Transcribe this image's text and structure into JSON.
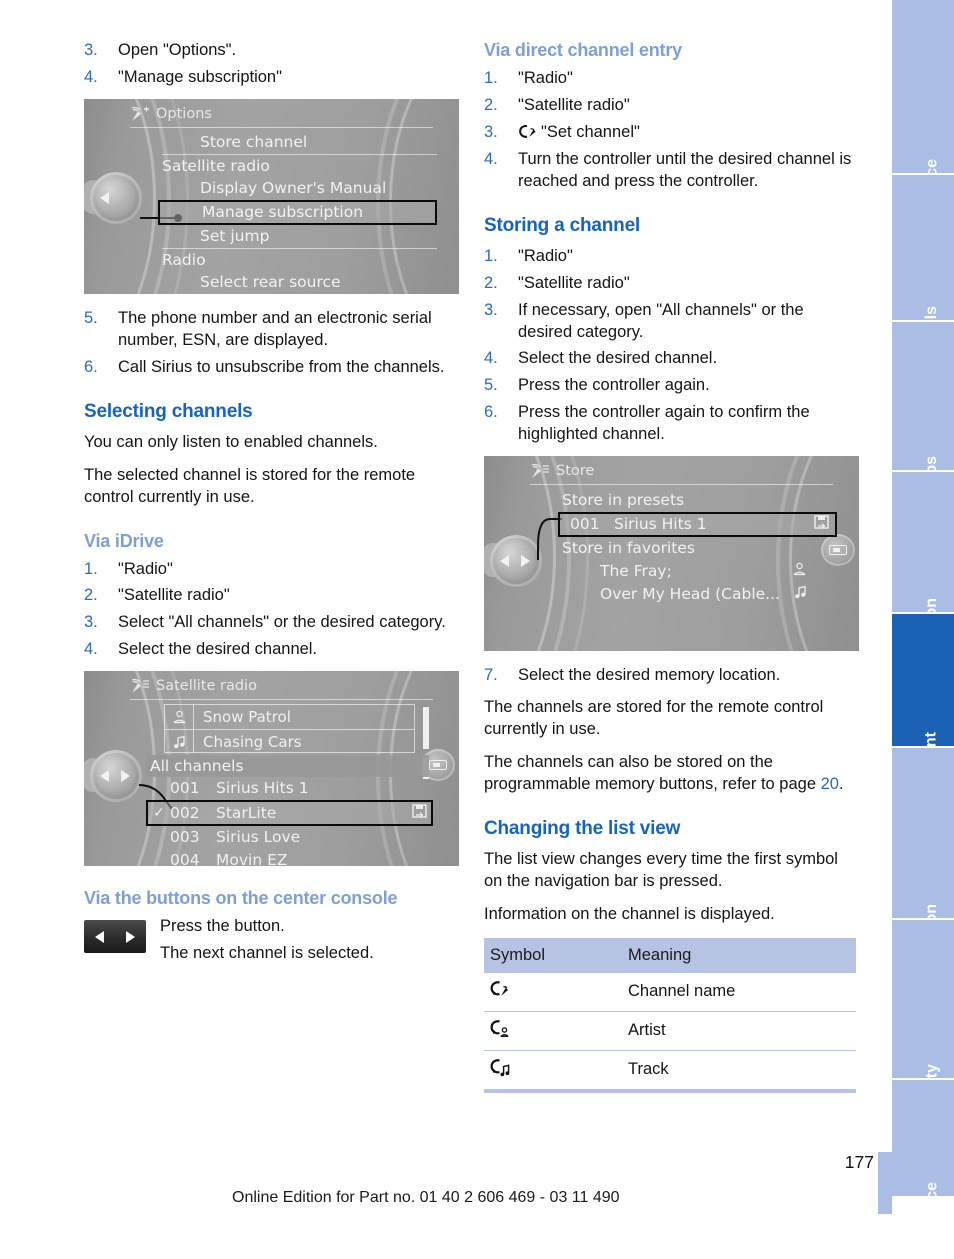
{
  "page": {
    "number": "177",
    "footer": "Online Edition for Part no. 01 40 2 606 469 - 03 11 490"
  },
  "sidebar": {
    "tabs": [
      {
        "label": "At a glance",
        "active": false
      },
      {
        "label": "Controls",
        "active": false
      },
      {
        "label": "Driving tips",
        "active": false
      },
      {
        "label": "Navigation",
        "active": false
      },
      {
        "label": "Entertainment",
        "active": true
      },
      {
        "label": "Communication",
        "active": false
      },
      {
        "label": "Mobility",
        "active": false
      },
      {
        "label": "Reference",
        "active": false
      }
    ],
    "active_color": "#1b62b5",
    "inactive_color": "#aabde4"
  },
  "left_column": {
    "steps_top": [
      {
        "num": "3.",
        "text": "Open \"Options\"."
      },
      {
        "num": "4.",
        "text": "\"Manage subscription\""
      }
    ],
    "options_screen": {
      "title": "Options",
      "icon": "satellite-plus-icon",
      "rows": [
        {
          "label": "Store channel",
          "indent": 2,
          "selected": false,
          "separator_above": false
        },
        {
          "label": "Satellite radio",
          "indent": 1,
          "selected": false,
          "separator_above": true
        },
        {
          "label": "Display Owner's Manual",
          "indent": 2,
          "selected": false,
          "separator_above": false
        },
        {
          "label": "Manage subscription",
          "indent": 2,
          "selected": true,
          "separator_above": false
        },
        {
          "label": "Set jump",
          "indent": 2,
          "selected": false,
          "separator_above": false
        },
        {
          "label": "Radio",
          "indent": 1,
          "selected": false,
          "separator_above": true
        },
        {
          "label": "Select rear source",
          "indent": 2,
          "selected": false,
          "separator_above": false
        }
      ]
    },
    "steps_bottom": [
      {
        "num": "5.",
        "text": "The phone number and an electronic serial number, ESN, are displayed."
      },
      {
        "num": "6.",
        "text": "Call Sirius to unsubscribe from the channels."
      }
    ],
    "selecting_channels": {
      "heading": "Selecting channels",
      "paragraphs": [
        "You can only listen to enabled channels.",
        "The selected channel is stored for the remote control currently in use."
      ]
    },
    "via_idrive": {
      "heading": "Via iDrive",
      "steps": [
        {
          "num": "1.",
          "text": "\"Radio\""
        },
        {
          "num": "2.",
          "text": "\"Satellite radio\""
        },
        {
          "num": "3.",
          "text": "Select \"All channels\" or the desired category."
        },
        {
          "num": "4.",
          "text": "Select the desired channel."
        }
      ]
    },
    "satellite_screen": {
      "title": "Satellite radio",
      "icon": "satellite-list-icon",
      "now_playing": [
        {
          "icon": "artist-icon",
          "text": "Snow Patrol"
        },
        {
          "icon": "track-icon",
          "text": "Chasing Cars"
        }
      ],
      "list_header": "All channels",
      "channels": [
        {
          "check": "",
          "number": "001",
          "name": "Sirius Hits 1",
          "selected": false,
          "badge": ""
        },
        {
          "check": "✓",
          "number": "002",
          "name": "StarLite",
          "selected": true,
          "badge": "store-icon"
        },
        {
          "check": "",
          "number": "003",
          "name": "Sirius Love",
          "selected": false,
          "badge": ""
        },
        {
          "check": "",
          "number": "004",
          "name": "Movin EZ",
          "selected": false,
          "badge": ""
        }
      ]
    },
    "via_buttons": {
      "heading": "Via the buttons on the center console",
      "button_icon": "prev-next-button",
      "lines": [
        "Press the button.",
        "The next channel is selected."
      ]
    }
  },
  "right_column": {
    "via_direct": {
      "heading": "Via direct channel entry",
      "steps": [
        {
          "num": "1.",
          "text": "\"Radio\"",
          "icon": ""
        },
        {
          "num": "2.",
          "text": "\"Satellite radio\"",
          "icon": ""
        },
        {
          "num": "3.",
          "text": "\"Set channel\"",
          "icon": "set-channel-icon"
        },
        {
          "num": "4.",
          "text": "Turn the controller until the desired channel is reached and press the controller.",
          "icon": ""
        }
      ]
    },
    "storing": {
      "heading": "Storing a channel",
      "steps": [
        {
          "num": "1.",
          "text": "\"Radio\""
        },
        {
          "num": "2.",
          "text": "\"Satellite radio\""
        },
        {
          "num": "3.",
          "text": "If necessary, open \"All channels\" or the desired category."
        },
        {
          "num": "4.",
          "text": "Select the desired channel."
        },
        {
          "num": "5.",
          "text": "Press the controller again."
        },
        {
          "num": "6.",
          "text": "Press the controller again to confirm the highlighted channel."
        }
      ]
    },
    "store_screen": {
      "title": "Store",
      "icon": "satellite-list-icon",
      "rows": [
        {
          "label": "Store in presets",
          "indent": 1,
          "selected": false,
          "badge": "",
          "number": ""
        },
        {
          "label": "Sirius Hits 1",
          "indent": 2,
          "selected": true,
          "badge": "store-icon",
          "number": "001"
        },
        {
          "label": "Store in favorites",
          "indent": 1,
          "selected": false,
          "badge": "",
          "number": ""
        },
        {
          "label": "The Fray;",
          "indent": 2,
          "selected": false,
          "badge": "artist-icon",
          "number": ""
        },
        {
          "label": "Over My Head (Cable...",
          "indent": 2,
          "selected": false,
          "badge": "track-icon",
          "number": ""
        }
      ]
    },
    "step7": {
      "num": "7.",
      "text": "Select the desired memory location."
    },
    "paragraphs": [
      "The channels are stored for the remote control currently in use."
    ],
    "memory_note": {
      "before": "The channels can also be stored on the programmable memory buttons, refer to page ",
      "pageref": "20",
      "after": "."
    },
    "changing_view": {
      "heading": "Changing the list view",
      "paragraphs": [
        "The list view changes every time the first symbol on the navigation bar is pressed.",
        "Information on the channel is displayed."
      ]
    },
    "symbol_table": {
      "headers": [
        "Symbol",
        "Meaning"
      ],
      "rows": [
        {
          "icon": "channel-name-icon",
          "meaning": "Channel name"
        },
        {
          "icon": "artist-name-icon",
          "meaning": "Artist"
        },
        {
          "icon": "track-name-icon",
          "meaning": "Track"
        }
      ]
    }
  }
}
